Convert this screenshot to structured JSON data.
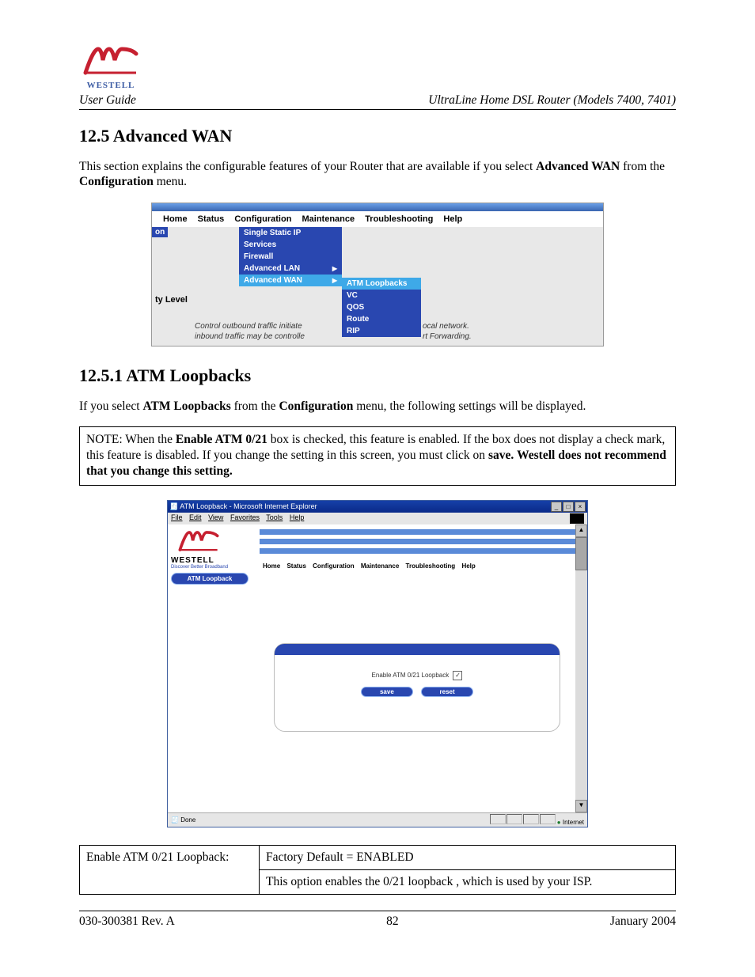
{
  "header": {
    "brand_under_text": "WESTELL",
    "user_guide": "User Guide",
    "product": "UltraLine Home DSL Router (Models 7400, 7401)"
  },
  "section1": {
    "heading": "12.5  Advanced WAN",
    "para_prefix": "This section explains the configurable features of your Router that are available if you select ",
    "para_bold1": "Advanced WAN",
    "para_mid": " from the ",
    "para_bold2": "Configuration",
    "para_suffix": " menu."
  },
  "menu_screenshot": {
    "nav": {
      "home": "Home",
      "status": "Status",
      "config": "Configuration",
      "maint": "Maintenance",
      "trouble": "Troubleshooting",
      "help": "Help"
    },
    "left_fragment": "on",
    "ty_level": "ty Level",
    "dropdown": {
      "single_static_ip": "Single Static IP",
      "services": "Services",
      "firewall": "Firewall",
      "adv_lan": "Advanced LAN",
      "adv_wan": "Advanced WAN"
    },
    "submenu": {
      "atm_loopbacks": "ATM Loopbacks",
      "vc": "VC",
      "qos": "QOS",
      "route": "Route",
      "rip": "RIP"
    },
    "bg_line1": "Control outbound traffic initiate",
    "bg_line2": "inbound traffic may be controlle",
    "bg_line3": "ocal network.",
    "bg_line4": "rt Forwarding."
  },
  "section2": {
    "heading": "12.5.1  ATM Loopbacks",
    "para_prefix": "If you select ",
    "para_bold1": "ATM Loopbacks",
    "para_mid1": " from the ",
    "para_bold2": "Configuration",
    "para_suffix": " menu, the following settings will be displayed."
  },
  "note": {
    "prefix": "NOTE: When the ",
    "bold1": "Enable ATM 0/21",
    "mid1": " box is checked, this feature is enabled. If the box does not display a check mark, this feature is disabled.  If you change the setting in this screen, you must click on ",
    "bold2": "save.",
    "mid2": " ",
    "bold3": "Westell does not recommend that you change this setting."
  },
  "browser_screenshot": {
    "title": "ATM Loopback - Microsoft Internet Explorer",
    "menubar": {
      "file": "File",
      "edit": "Edit",
      "view": "View",
      "favorites": "Favorites",
      "tools": "Tools",
      "help": "Help"
    },
    "brand": "WESTELL",
    "tagline": "Discover Better Broadband",
    "left_pill": "ATM Loopback",
    "nav": {
      "home": "Home",
      "status": "Status",
      "config": "Configuration",
      "maint": "Maintenance",
      "trouble": "Troubleshooting",
      "help": "Help"
    },
    "checkbox_label": "Enable ATM 0/21 Loopback",
    "checkbox_mark": "✓",
    "save": "save",
    "reset": "reset",
    "status_done": "Done",
    "status_internet": "Internet"
  },
  "settings_table": {
    "row_label": "Enable ATM 0/21 Loopback:",
    "row_default": "Factory Default = ENABLED",
    "row_desc": "This option enables the 0/21 loopback , which is used by your ISP."
  },
  "footer": {
    "left": "030-300381 Rev. A",
    "center": "82",
    "right": "January 2004"
  }
}
